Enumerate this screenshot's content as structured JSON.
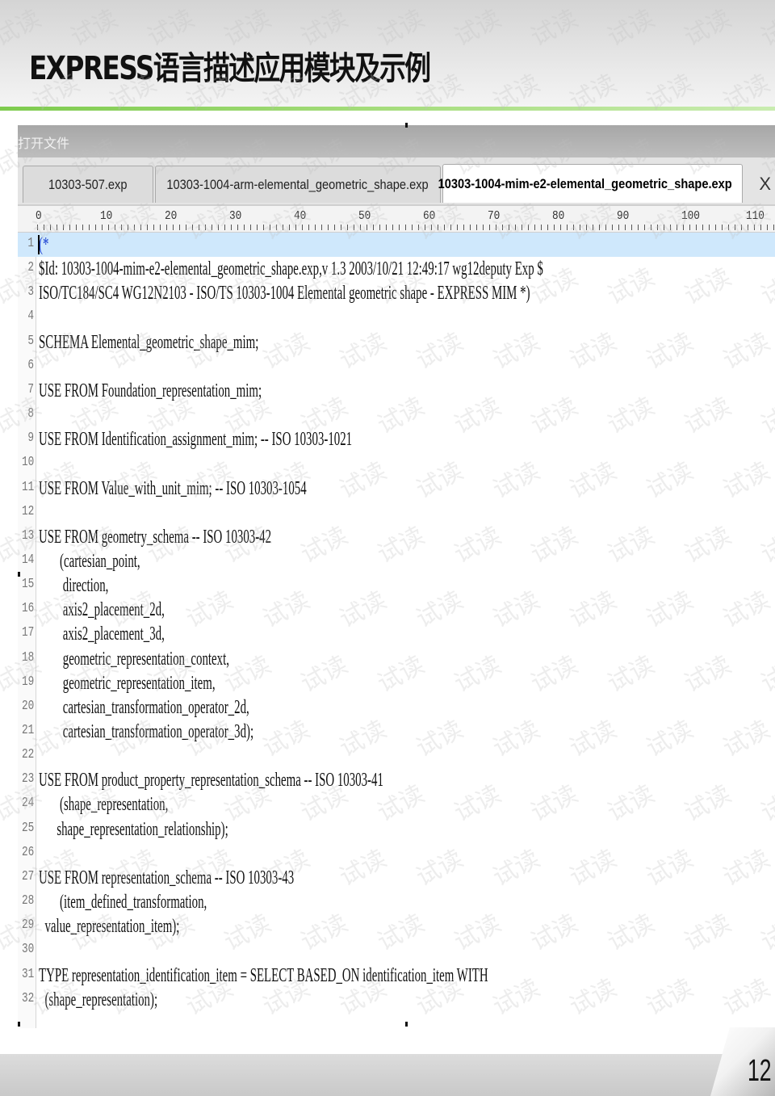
{
  "slide": {
    "title": "EXPRESS语言描述应用模块及示例",
    "page_number": "12",
    "watermark_text": "试读"
  },
  "window": {
    "title": "打开文件"
  },
  "tabs": [
    {
      "label": "10303-507.exp",
      "active": false
    },
    {
      "label": "10303-1004-arm-elemental_geometric_shape.exp",
      "active": false
    },
    {
      "label": "10303-1004-mim-e2-elemental_geometric_shape.exp",
      "active": true,
      "close_glyph": "X"
    }
  ],
  "ruler": {
    "labels": [
      "0",
      "10",
      "20",
      "30",
      "40",
      "50",
      "60",
      "70",
      "80",
      "90",
      "100",
      "110"
    ]
  },
  "editor": {
    "current_line": 1,
    "lines": [
      {
        "n": "1",
        "text": "(*"
      },
      {
        "n": "2",
        "text": "$Id: 10303-1004-mim-e2-elemental_geometric_shape.exp,v 1.3 2003/10/21 12:49:17 wg12deputy Exp $"
      },
      {
        "n": "3",
        "text": "ISO/TC184/SC4 WG12N2103 - ISO/TS 10303-1004 Elemental geometric shape - EXPRESS MIM *)"
      },
      {
        "n": "4",
        "text": ""
      },
      {
        "n": "5",
        "text": "SCHEMA Elemental_geometric_shape_mim;"
      },
      {
        "n": "6",
        "text": ""
      },
      {
        "n": "7",
        "text": "USE FROM Foundation_representation_mim;"
      },
      {
        "n": "8",
        "text": ""
      },
      {
        "n": "9",
        "text": "USE FROM Identification_assignment_mim; -- ISO 10303-1021"
      },
      {
        "n": "10",
        "text": ""
      },
      {
        "n": "11",
        "text": "USE FROM Value_with_unit_mim; -- ISO 10303-1054"
      },
      {
        "n": "12",
        "text": ""
      },
      {
        "n": "13",
        "text": "USE FROM geometry_schema -- ISO 10303-42"
      },
      {
        "n": "14",
        "text": "       (cartesian_point,"
      },
      {
        "n": "15",
        "text": "        direction,"
      },
      {
        "n": "16",
        "text": "        axis2_placement_2d,"
      },
      {
        "n": "17",
        "text": "        axis2_placement_3d,"
      },
      {
        "n": "18",
        "text": "        geometric_representation_context,"
      },
      {
        "n": "19",
        "text": "        geometric_representation_item,"
      },
      {
        "n": "20",
        "text": "        cartesian_transformation_operator_2d,"
      },
      {
        "n": "21",
        "text": "        cartesian_transformation_operator_3d);"
      },
      {
        "n": "22",
        "text": ""
      },
      {
        "n": "23",
        "text": "USE FROM product_property_representation_schema -- ISO 10303-41"
      },
      {
        "n": "24",
        "text": "       (shape_representation,"
      },
      {
        "n": "25",
        "text": "      shape_representation_relationship);"
      },
      {
        "n": "26",
        "text": ""
      },
      {
        "n": "27",
        "text": "USE FROM representation_schema -- ISO 10303-43"
      },
      {
        "n": "28",
        "text": "       (item_defined_transformation,"
      },
      {
        "n": "29",
        "text": "  value_representation_item);"
      },
      {
        "n": "30",
        "text": ""
      },
      {
        "n": "31",
        "text": "TYPE representation_identification_item = SELECT BASED_ON identification_item WITH"
      },
      {
        "n": "32",
        "text": "  (shape_representation);"
      }
    ]
  }
}
